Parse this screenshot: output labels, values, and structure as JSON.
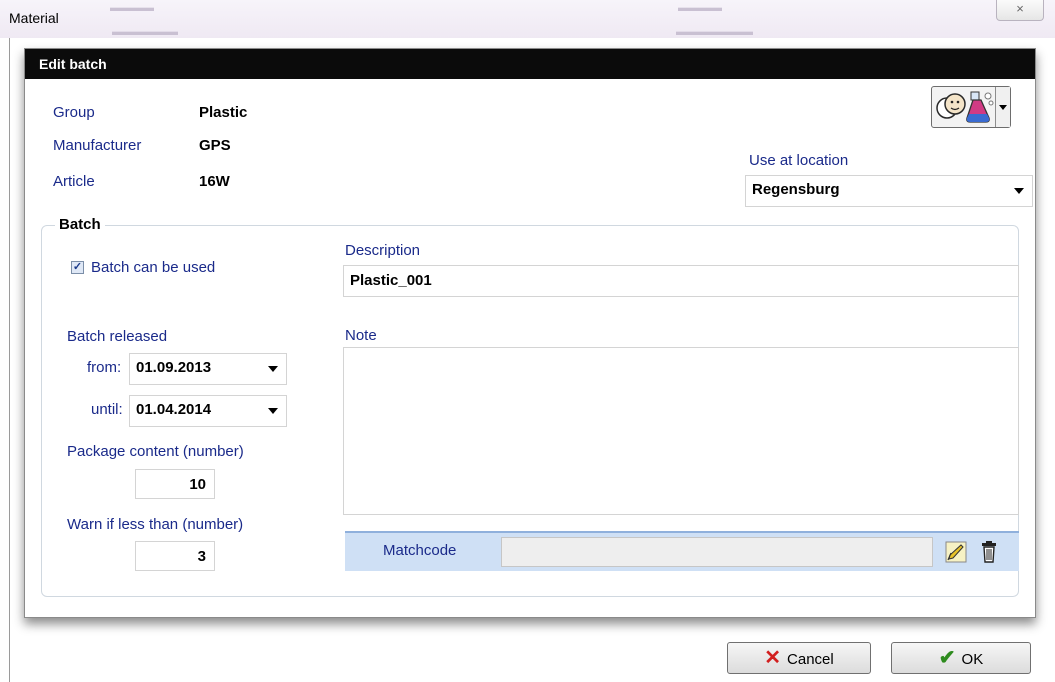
{
  "outer_window": {
    "title": "Material",
    "close_glyph": "×"
  },
  "dialog": {
    "title": "Edit batch",
    "info": {
      "group_label": "Group",
      "group_value": "Plastic",
      "manufacturer_label": "Manufacturer",
      "manufacturer_value": "GPS",
      "article_label": "Article",
      "article_value": "16W"
    },
    "location": {
      "label": "Use at location",
      "value": "Regensburg"
    },
    "batch": {
      "group_title": "Batch",
      "can_be_used_label": "Batch can be used",
      "can_be_used_checked": true,
      "released_label": "Batch released",
      "from_label": "from:",
      "from_value": "01.09.2013",
      "until_label": "until:",
      "until_value": "01.04.2014",
      "package_label": "Package content (number)",
      "package_value": "10",
      "warn_label": "Warn if less than (number)",
      "warn_value": "3",
      "description_label": "Description",
      "description_value": "Plastic_001",
      "note_label": "Note",
      "note_value": "",
      "matchcode_label": "Matchcode",
      "matchcode_value": ""
    }
  },
  "buttons": {
    "cancel_label": "Cancel",
    "ok_label": "OK"
  },
  "colors": {
    "label_blue": "#1a2a8a",
    "header_bg": "#0b0b0b",
    "matchcode_bg": "#cfe0f5",
    "cancel_icon": "#d21f1f",
    "ok_icon": "#2e8b1e"
  },
  "icons": [
    "people-lab-icon",
    "chevron-down-icon",
    "pencil-edit-icon",
    "trash-icon",
    "x-icon",
    "checkmark-icon"
  ]
}
